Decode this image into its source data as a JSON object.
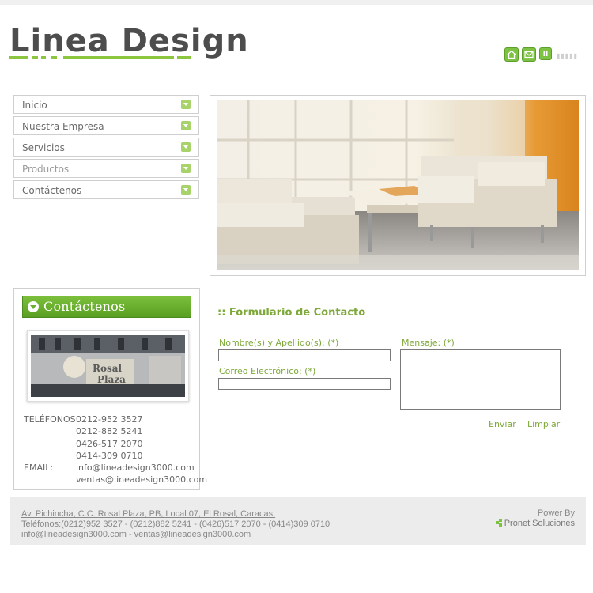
{
  "logo": {
    "text": "Linea Design"
  },
  "header_icons": [
    "home-icon",
    "mail-icon",
    "pause-icon"
  ],
  "nav": {
    "items": [
      {
        "label": "Inicio"
      },
      {
        "label": "Nuestra Empresa"
      },
      {
        "label": "Servicios"
      },
      {
        "label": "Productos"
      },
      {
        "label": "Contáctenos"
      }
    ]
  },
  "contact_panel": {
    "title": "Contáctenos",
    "phones_label": "TELÉFONOS:",
    "phones": [
      "0212-952 3527",
      "0212-882 5241",
      "0426-517 2070",
      "0414-309 0710"
    ],
    "email_label": "EMAIL:",
    "emails": [
      "info@lineadesign3000.com",
      "ventas@lineadesign3000.com"
    ]
  },
  "form": {
    "title": ":: Formulario de Contacto",
    "name_label": "Nombre(s) y Apellido(s): (*)",
    "email_label": "Correo Electrónico: (*)",
    "message_label": "Mensaje: (*)",
    "name_value": "",
    "email_value": "",
    "message_value": "",
    "send_label": "Enviar",
    "clear_label": "Limpiar"
  },
  "footer": {
    "address": "Av. Pichincha, C.C. Rosal Plaza, PB, Local 07, El Rosal, Caracas.",
    "phones": "Teléfonos:(0212)952 3527 - (0212)882 5241 - (0426)517 2070 - (0414)309 0710",
    "emails": "info@lineadesign3000.com - ventas@lineadesign3000.com",
    "power_by": "Power By",
    "pronet": "Pronet Soluciones"
  },
  "colors": {
    "accent": "#7dc242",
    "form_text": "#7ea93a",
    "footer_bg": "#ececec"
  }
}
